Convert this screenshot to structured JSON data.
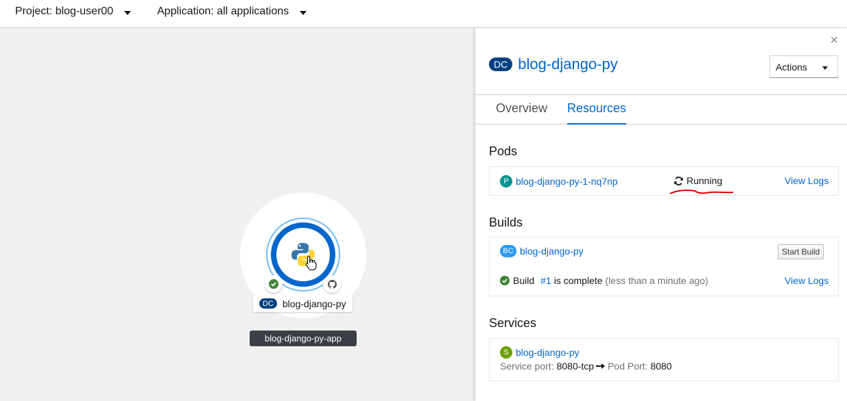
{
  "topbar": {
    "project": "Project: blog-user00",
    "application": "Application: all applications"
  },
  "topology": {
    "node_badge": "DC",
    "node_label": "blog-django-py",
    "app_label": "blog-django-py-app",
    "icons": [
      "python-icon",
      "hand-cursor-icon",
      "check-circle-icon",
      "github-icon"
    ]
  },
  "panel": {
    "close": "×",
    "title_badge": "DC",
    "title": "blog-django-py",
    "actions_label": "Actions",
    "tabs": [
      "Overview",
      "Resources"
    ],
    "active_tab": "Resources",
    "pods": {
      "heading": "Pods",
      "badge": "P",
      "name": "blog-django-py-1-nq7np",
      "status": "Running",
      "logs": "View Logs"
    },
    "builds": {
      "heading": "Builds",
      "badge": "BC",
      "name": "blog-django-py",
      "start_build": "Start Build",
      "build_word": "Build",
      "build_number": "#1",
      "build_status": "is complete",
      "build_time": "(less than a minute ago)",
      "logs": "View Logs"
    },
    "services": {
      "heading": "Services",
      "badge": "S",
      "name": "blog-django-py",
      "service_port_label": "Service port:",
      "service_port": "8080-tcp",
      "pod_port_label": "Pod Port:",
      "pod_port": "8080"
    }
  },
  "colors": {
    "link": "#0066cc",
    "dc_badge": "#004080",
    "pod_badge": "#009596",
    "bc_badge": "#2b9af3",
    "service_badge": "#6ca100",
    "success": "#3e8635",
    "annotation": "#e00000"
  }
}
